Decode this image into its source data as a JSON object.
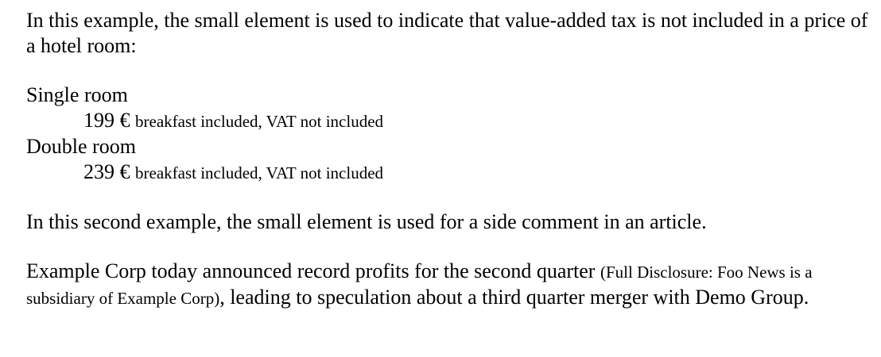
{
  "intro": {
    "text": "In this example, the small element is used to indicate that value-added tax is not included in a price of a hotel room:"
  },
  "rooms": [
    {
      "name": "Single room",
      "price": "199 €",
      "note": "breakfast included, VAT not included"
    },
    {
      "name": "Double room",
      "price": "239 €",
      "note": "breakfast included, VAT not included"
    }
  ],
  "second_example": {
    "text": "In this second example, the small element is used for a side comment in an article."
  },
  "article": {
    "before": "Example Corp today announced record profits for the second quarter",
    "side_comment": "(Full Disclosure: Foo News is a subsidiary of Example Corp)",
    "after": ", leading to speculation about a third quarter merger with Demo Group."
  }
}
